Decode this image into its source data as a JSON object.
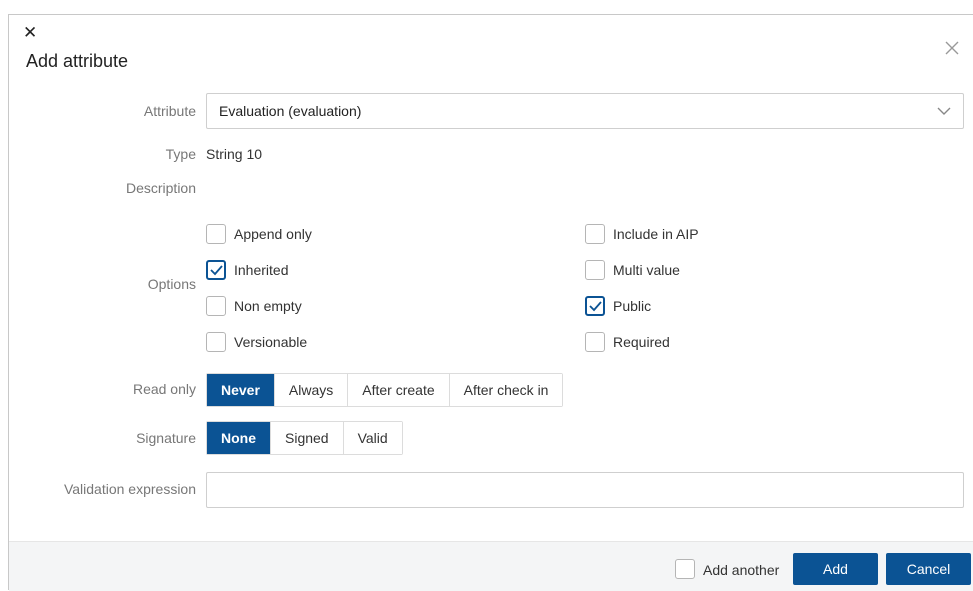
{
  "dialog": {
    "title": "Add attribute",
    "icons": {
      "top_close": "close-icon",
      "corner_close": "close-icon",
      "dropdown": "chevron-down-icon",
      "check": "check-icon"
    }
  },
  "form": {
    "attribute_label": "Attribute",
    "attribute_value": "Evaluation (evaluation)",
    "type_label": "Type",
    "type_value": "String 10",
    "description_label": "Description",
    "options_label": "Options",
    "options": [
      {
        "label": "Append only",
        "checked": false
      },
      {
        "label": "Inherited",
        "checked": true
      },
      {
        "label": "Non empty",
        "checked": false
      },
      {
        "label": "Versionable",
        "checked": false
      },
      {
        "label": "Include in AIP",
        "checked": false
      },
      {
        "label": "Multi value",
        "checked": false
      },
      {
        "label": "Public",
        "checked": true
      },
      {
        "label": "Required",
        "checked": false
      }
    ],
    "read_only_label": "Read only",
    "read_only_options": [
      "Never",
      "Always",
      "After create",
      "After check in"
    ],
    "read_only_selected": "Never",
    "signature_label": "Signature",
    "signature_options": [
      "None",
      "Signed",
      "Valid"
    ],
    "signature_selected": "None",
    "validation_label": "Validation expression",
    "validation_value": ""
  },
  "footer": {
    "add_another_label": "Add another",
    "add_another_checked": false,
    "add_label": "Add",
    "cancel_label": "Cancel"
  },
  "colors": {
    "accent": "#0b5394",
    "footer_bg": "#f4f5f6"
  }
}
